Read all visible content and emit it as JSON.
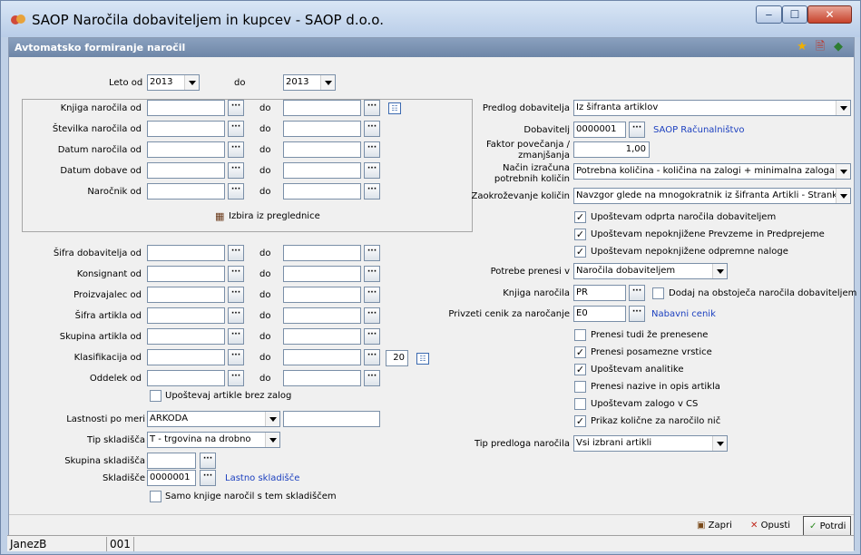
{
  "window": {
    "title": "SAOP Naročila dobaviteljem in kupcev - SAOP d.o.o.",
    "min": "‒",
    "max": "☐",
    "close": "✕"
  },
  "form": {
    "title": "Avtomatsko formiranje naročil"
  },
  "year": {
    "from_label": "Leto od",
    "from": "2013",
    "to_label": "do",
    "to": "2013"
  },
  "do": "do",
  "group": [
    {
      "label": "Knjiga naročila od"
    },
    {
      "label": "Številka naročila od"
    },
    {
      "label": "Datum naročila od"
    },
    {
      "label": "Datum dobave od"
    },
    {
      "label": "Naročnik od"
    }
  ],
  "izbira": "Izbira iz preglednice",
  "ranges": [
    {
      "label": "Šifra dobavitelja od"
    },
    {
      "label": "Konsignant od"
    },
    {
      "label": "Proizvajalec od"
    },
    {
      "label": "Šifra artikla od"
    },
    {
      "label": "Skupina artikla od"
    },
    {
      "label": "Klasifikacija od"
    },
    {
      "label": "Oddelek od"
    }
  ],
  "klas_num": "20",
  "brez_zalog": "Upoštevaj artikle brez zalog",
  "lastnosti": {
    "label": "Lastnosti po meri",
    "value": "ARKODA"
  },
  "tip_skl": {
    "label": "Tip skladišča",
    "value": "T - trgovina na drobno"
  },
  "skupina_skl": {
    "label": "Skupina skladišča"
  },
  "skladisce": {
    "label": "Skladišče",
    "value": "0000001",
    "link": "Lastno skladišče"
  },
  "samo_knjige": "Samo knjige naročil s tem skladiščem",
  "right": {
    "predlog": {
      "label": "Predlog dobavitelja",
      "value": "Iz šifranta artiklov"
    },
    "dobavitelj": {
      "label": "Dobavitelj",
      "value": "0000001",
      "link": "SAOP Računalništvo"
    },
    "faktor": {
      "label1": "Faktor povečanja /",
      "label2": "zmanjšanja",
      "value": "1,00"
    },
    "nacin": {
      "label1": "Način izračuna",
      "label2": "potrebnih količin",
      "value": "Potrebna količina - količina na zalogi + minimalna zaloga"
    },
    "zaokr": {
      "label": "Zaokroževanje količin",
      "value": "Navzgor glede na mnogokratnik iz šifranta Artikli - Stranke"
    },
    "checks1": [
      {
        "label": "Upoštevam odprta naročila dobaviteljem",
        "checked": true
      },
      {
        "label": "Upoštevam nepoknjižene Prevzeme in Predprejeme",
        "checked": true
      },
      {
        "label": "Upoštevam nepoknjižene odpremne naloge",
        "checked": true
      }
    ],
    "potrebe": {
      "label": "Potrebe prenesi v",
      "value": "Naročila dobaviteljem"
    },
    "knjiga": {
      "label": "Knjiga naročila",
      "value": "PR",
      "check": "Dodaj na obstoječa naročila dobaviteljem"
    },
    "cenik": {
      "label": "Privzeti cenik za naročanje",
      "value": "E0",
      "link": "Nabavni cenik"
    },
    "checks2": [
      {
        "label": "Prenesi tudi že prenesene",
        "checked": false
      },
      {
        "label": "Prenesi posamezne vrstice",
        "checked": true
      },
      {
        "label": "Upoštevam analitike",
        "checked": true
      },
      {
        "label": "Prenesi nazive in opis artikla",
        "checked": false
      },
      {
        "label": "Upoštevam zalogo v CS",
        "checked": false
      },
      {
        "label": "Prikaz količne za naročilo nič",
        "checked": true
      }
    ],
    "tip_predloga": {
      "label": "Tip predloga naročila",
      "value": "Vsi izbrani artikli"
    }
  },
  "buttons": {
    "zapri": "Zapri",
    "opusti": "Opusti",
    "potrdi": "Potrdi"
  },
  "status": {
    "user": "JanezB",
    "code": "001"
  }
}
